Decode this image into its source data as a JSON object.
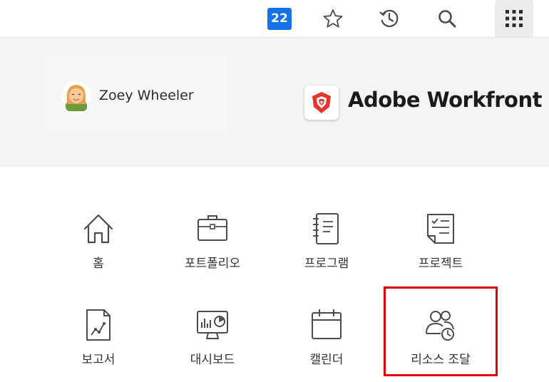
{
  "toolbar": {
    "notifications_count": "22",
    "badge_color": "#1473e6",
    "icons": [
      "star-icon",
      "history-icon",
      "search-icon",
      "apps-grid-icon"
    ]
  },
  "header": {
    "user_name": "Zoey Wheeler",
    "brand_name": "Adobe Workfront",
    "brand_color": "#e8352b"
  },
  "menu": {
    "items": [
      {
        "label": "홈",
        "icon": "home-icon"
      },
      {
        "label": "포트폴리오",
        "icon": "portfolio-icon"
      },
      {
        "label": "프로그램",
        "icon": "program-icon"
      },
      {
        "label": "프로젝트",
        "icon": "project-icon"
      },
      {
        "label": "보고서",
        "icon": "report-icon"
      },
      {
        "label": "대시보드",
        "icon": "dashboard-icon"
      },
      {
        "label": "캘린더",
        "icon": "calendar-icon"
      },
      {
        "label": "리소스 조달",
        "icon": "resourcing-icon"
      }
    ],
    "highlight_color": "#e00000"
  }
}
